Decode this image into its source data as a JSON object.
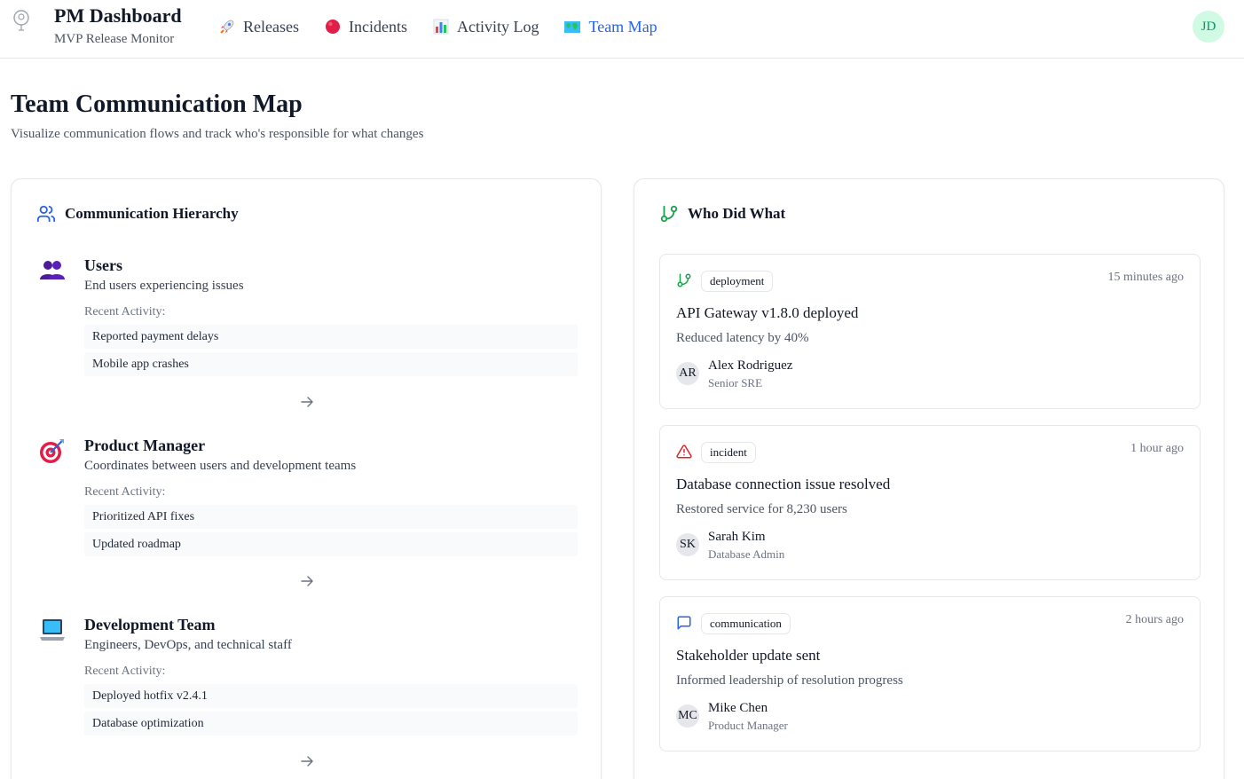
{
  "header": {
    "title": "PM Dashboard",
    "subtitle": "MVP Release Monitor",
    "nav": [
      {
        "label": "Releases",
        "icon": "rocket-icon"
      },
      {
        "label": "Incidents",
        "icon": "red-circle-icon"
      },
      {
        "label": "Activity Log",
        "icon": "bar-chart-icon"
      },
      {
        "label": "Team Map",
        "icon": "world-map-icon",
        "active": true
      }
    ],
    "user_initials": "JD"
  },
  "page": {
    "title": "Team Communication Map",
    "subtitle": "Visualize communication flows and track who's responsible for what changes"
  },
  "hierarchy": {
    "title": "Communication Hierarchy",
    "recent_label": "Recent Activity:",
    "levels": [
      {
        "title": "Users",
        "description": "End users experiencing issues",
        "icon": "users-emoji-icon",
        "activities": [
          "Reported payment delays",
          "Mobile app crashes"
        ]
      },
      {
        "title": "Product Manager",
        "description": "Coordinates between users and development teams",
        "icon": "target-emoji-icon",
        "activities": [
          "Prioritized API fixes",
          "Updated roadmap"
        ]
      },
      {
        "title": "Development Team",
        "description": "Engineers, DevOps, and technical staff",
        "icon": "laptop-emoji-icon",
        "activities": [
          "Deployed hotfix v2.4.1",
          "Database optimization"
        ]
      }
    ]
  },
  "who_did_what": {
    "title": "Who Did What",
    "items": [
      {
        "type": "deployment",
        "icon": "git-branch-icon",
        "time": "15 minutes ago",
        "title": "API Gateway v1.8.0 deployed",
        "description": "Reduced latency by 40%",
        "initials": "AR",
        "name": "Alex Rodriguez",
        "role": "Senior SRE"
      },
      {
        "type": "incident",
        "icon": "alert-triangle-icon",
        "time": "1 hour ago",
        "title": "Database connection issue resolved",
        "description": "Restored service for 8,230 users",
        "initials": "SK",
        "name": "Sarah Kim",
        "role": "Database Admin"
      },
      {
        "type": "communication",
        "icon": "message-square-icon",
        "time": "2 hours ago",
        "title": "Stakeholder update sent",
        "description": "Informed leadership of resolution progress",
        "initials": "MC",
        "name": "Mike Chen",
        "role": "Product Manager"
      }
    ]
  },
  "colors": {
    "accent": "#2563eb",
    "success": "#16a34a",
    "danger": "#dc2626",
    "avatar_bg": "#d1fae5"
  }
}
